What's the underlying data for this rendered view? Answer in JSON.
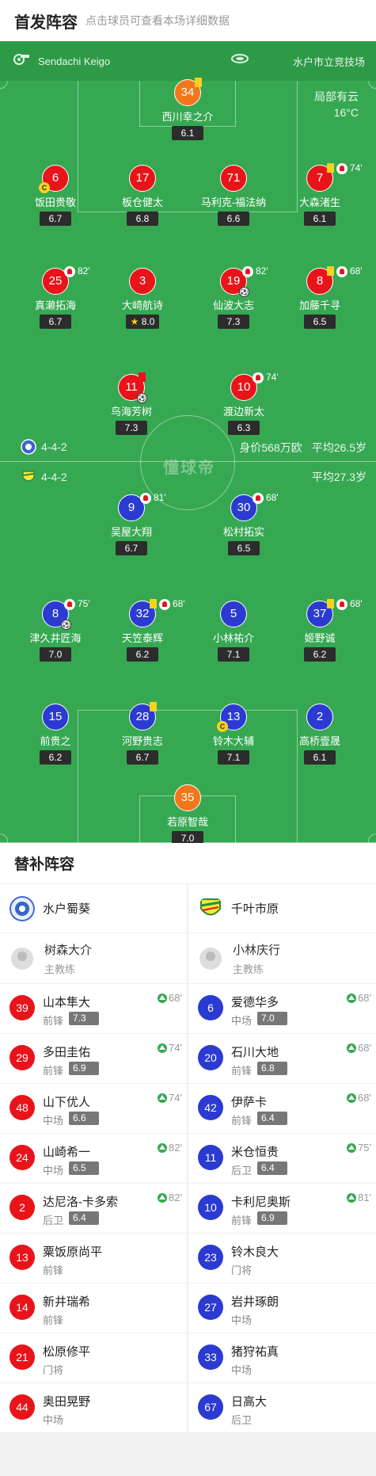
{
  "header": {
    "title": "首发阵容",
    "subtitle": "点击球员可查看本场详细数据"
  },
  "pitch": {
    "coach": "Sendachi Keigo",
    "venue": "水户市立竞技场",
    "weather": {
      "condition": "局部有云",
      "temp": "16°C"
    },
    "watermark": "懂球帝",
    "home": {
      "formation": "4-4-2",
      "value": "身价568万欧",
      "age": "平均26.5岁"
    },
    "away": {
      "formation": "4-4-2",
      "age": "平均27.3岁"
    },
    "players": [
      {
        "num": "34",
        "name": "西川幸之介",
        "rating": "6.1",
        "color": "orange"
      },
      {
        "num": "6",
        "name": "饭田贵敬",
        "rating": "6.7",
        "color": "red"
      },
      {
        "num": "17",
        "name": "板仓健太",
        "rating": "6.8",
        "color": "red"
      },
      {
        "num": "71",
        "name": "马利克-福法纳",
        "rating": "6.6",
        "color": "red"
      },
      {
        "num": "7",
        "name": "大森渚生",
        "rating": "6.1",
        "color": "red",
        "sub": "74'"
      },
      {
        "num": "25",
        "name": "真濑拓海",
        "rating": "6.7",
        "color": "red",
        "sub": "82'"
      },
      {
        "num": "3",
        "name": "大崎航诗",
        "rating": "8.0",
        "color": "red"
      },
      {
        "num": "19",
        "name": "仙波大志",
        "rating": "7.3",
        "color": "red",
        "sub": "82'"
      },
      {
        "num": "8",
        "name": "加藤千寻",
        "rating": "6.5",
        "color": "red",
        "sub": "68'"
      },
      {
        "num": "11",
        "name": "鸟海芳树",
        "rating": "7.3",
        "color": "red"
      },
      {
        "num": "10",
        "name": "渡边新太",
        "rating": "6.3",
        "color": "red",
        "sub": "74'"
      },
      {
        "num": "9",
        "name": "吴屋大翔",
        "rating": "6.7",
        "color": "blue",
        "sub": "81'"
      },
      {
        "num": "30",
        "name": "松村拓实",
        "rating": "6.5",
        "color": "blue",
        "sub": "68'"
      },
      {
        "num": "8",
        "name": "津久井匠海",
        "rating": "7.0",
        "color": "blue",
        "sub": "75'"
      },
      {
        "num": "32",
        "name": "天笠泰辉",
        "rating": "6.2",
        "color": "blue",
        "sub": "68'"
      },
      {
        "num": "5",
        "name": "小林祐介",
        "rating": "7.1",
        "color": "blue"
      },
      {
        "num": "37",
        "name": "姬野诚",
        "rating": "6.2",
        "color": "blue",
        "sub": "68'"
      },
      {
        "num": "15",
        "name": "前贵之",
        "rating": "6.2",
        "color": "blue"
      },
      {
        "num": "28",
        "name": "河野贵志",
        "rating": "6.7",
        "color": "blue"
      },
      {
        "num": "13",
        "name": "铃木大辅",
        "rating": "7.1",
        "color": "blue"
      },
      {
        "num": "2",
        "name": "高桥壹晟",
        "rating": "6.1",
        "color": "blue"
      },
      {
        "num": "35",
        "name": "若原智哉",
        "rating": "7.0",
        "color": "orange"
      }
    ]
  },
  "subs": {
    "title": "替补阵容",
    "left": {
      "team": "水户蜀葵",
      "coach": {
        "name": "树森大介",
        "role": "主教练"
      },
      "players": [
        {
          "num": "39",
          "name": "山本隼大",
          "pos": "前锋",
          "rating": "7.3",
          "in": "68'"
        },
        {
          "num": "29",
          "name": "多田圭佑",
          "pos": "前锋",
          "rating": "6.9",
          "in": "74'"
        },
        {
          "num": "48",
          "name": "山下优人",
          "pos": "中场",
          "rating": "6.6",
          "in": "74'"
        },
        {
          "num": "24",
          "name": "山崎希一",
          "pos": "中场",
          "rating": "6.5",
          "in": "82'"
        },
        {
          "num": "2",
          "name": "达尼洛-卡多索",
          "pos": "后卫",
          "rating": "6.4",
          "in": "82'"
        },
        {
          "num": "13",
          "name": "粟饭原尚平",
          "pos": "前锋"
        },
        {
          "num": "14",
          "name": "新井瑞希",
          "pos": "前锋"
        },
        {
          "num": "21",
          "name": "松原修平",
          "pos": "门将"
        },
        {
          "num": "44",
          "name": "奥田晃野",
          "pos": "中场"
        }
      ]
    },
    "right": {
      "team": "千叶市原",
      "coach": {
        "name": "小林庆行",
        "role": "主教练"
      },
      "players": [
        {
          "num": "6",
          "name": "爱德华多",
          "pos": "中场",
          "rating": "7.0",
          "in": "68'"
        },
        {
          "num": "20",
          "name": "石川大地",
          "pos": "前锋",
          "rating": "6.8",
          "in": "68'"
        },
        {
          "num": "42",
          "name": "伊萨卡",
          "pos": "前锋",
          "rating": "6.4",
          "in": "68'"
        },
        {
          "num": "11",
          "name": "米仓恒贵",
          "pos": "后卫",
          "rating": "6.4",
          "in": "75'"
        },
        {
          "num": "10",
          "name": "卡利尼奥斯",
          "pos": "前锋",
          "rating": "6.9",
          "in": "81'"
        },
        {
          "num": "23",
          "name": "铃木良大",
          "pos": "门将"
        },
        {
          "num": "27",
          "name": "岩井琢朗",
          "pos": "中场"
        },
        {
          "num": "33",
          "name": "猪狩祐真",
          "pos": "中场"
        },
        {
          "num": "67",
          "name": "日高大",
          "pos": "后卫"
        }
      ]
    }
  }
}
